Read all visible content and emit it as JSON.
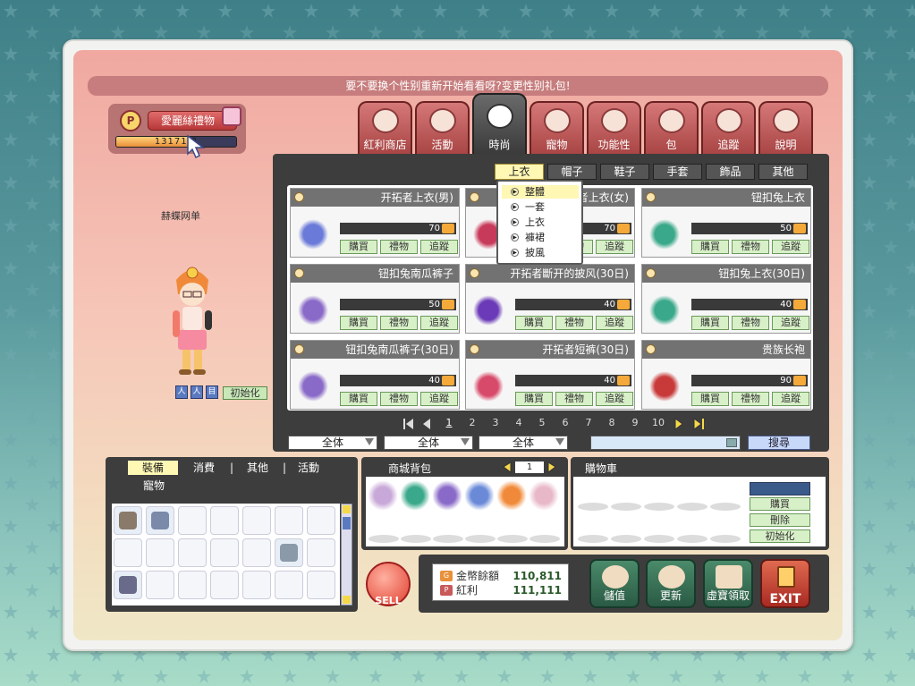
{
  "notice": "要不要换个性别重新开始看看呀?变更性别礼包!",
  "gift": {
    "button_label": "愛麗絲禮物",
    "points_text": "13171 3",
    "progress": 0.62
  },
  "character": {
    "name": "赫蝶网单",
    "reset_label": "初始化",
    "buttons": [
      "人",
      "人",
      "目"
    ]
  },
  "tabs": [
    {
      "label": "紅利商店",
      "icon": "p-coin-icon"
    },
    {
      "label": "活動",
      "icon": "flower-icon"
    },
    {
      "label": "時尚",
      "icon": "hanger-icon",
      "active": true
    },
    {
      "label": "寵物",
      "icon": "pet-icon"
    },
    {
      "label": "功能性",
      "icon": "gears-icon"
    },
    {
      "label": "包",
      "icon": "gift-bow-icon"
    },
    {
      "label": "追蹤",
      "icon": "cart-icon"
    },
    {
      "label": "說明",
      "icon": "lightbulb-icon"
    }
  ],
  "subtabs": [
    "上衣",
    "帽子",
    "鞋子",
    "手套",
    "飾品",
    "其他"
  ],
  "dropdown": [
    "整體",
    "一套",
    "上衣",
    "褲裙",
    "披風"
  ],
  "buttons": {
    "buy": "購買",
    "gift": "禮物",
    "track": "追蹤"
  },
  "items": [
    {
      "name": "开拓者上衣(男)",
      "price": "70",
      "color": "#6a7ad8"
    },
    {
      "name": "开拓者上衣(女)",
      "price": "70",
      "color": "#c83a5a"
    },
    {
      "name": "钮扣兔上衣",
      "price": "50",
      "color": "#3aa88a"
    },
    {
      "name": "钮扣兔南瓜裤子",
      "price": "50",
      "color": "#8a6ac8"
    },
    {
      "name": "开拓者斷开的披风(30日)",
      "price": "40",
      "color": "#6a3ab8"
    },
    {
      "name": "钮扣兔上衣(30日)",
      "price": "40",
      "color": "#3aa88a"
    },
    {
      "name": "钮扣兔南瓜裤子(30日)",
      "price": "40",
      "color": "#8a6ac8"
    },
    {
      "name": "开拓者短裤(30日)",
      "price": "40",
      "color": "#d84a6a"
    },
    {
      "name": "贵族长袍",
      "price": "90",
      "color": "#c83a3a"
    }
  ],
  "pager": {
    "pages": [
      "1",
      "2",
      "3",
      "4",
      "5",
      "6",
      "7",
      "8",
      "9",
      "10"
    ],
    "current": "1"
  },
  "filters": [
    "全体",
    "全体",
    "全体"
  ],
  "search": {
    "button": "搜尋",
    "value": ""
  },
  "inventory": {
    "tabs": [
      "裝備",
      "消費",
      "其他",
      "活動"
    ],
    "separators": [
      "|",
      "|"
    ],
    "second_row": "寵物"
  },
  "cash_bag": {
    "title": "商城背包",
    "page": "1"
  },
  "cart": {
    "title": "購物車",
    "buttons": [
      "購買",
      "刪除",
      "初始化"
    ]
  },
  "balance": {
    "mesos_label": "金幣餘額",
    "mesos_value": "110,811",
    "points_label": "紅利",
    "points_value": "111,111"
  },
  "actions": [
    "儲值",
    "更新",
    "虛寶領取"
  ],
  "exit_label": "EXIT",
  "sell_label": "SELL"
}
